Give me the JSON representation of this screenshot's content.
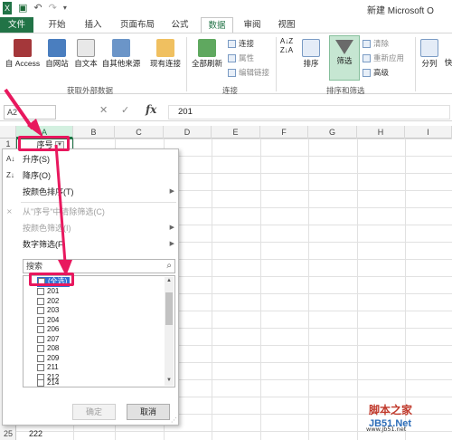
{
  "window": {
    "title": "新建 Microsoft O"
  },
  "tabs": [
    "文件",
    "开始",
    "插入",
    "页面布局",
    "公式",
    "数据",
    "审阅",
    "视图"
  ],
  "ribbon": {
    "from_access": "自 Access",
    "from_web": "自网站",
    "from_text": "自文本",
    "from_other": "自其他来源",
    "existing": "现有连接",
    "refresh_all": "全部刷新",
    "connections": "连接",
    "properties": "属性",
    "edit_links": "编辑链接",
    "sort": "排序",
    "filter": "筛选",
    "clear": "清除",
    "reapply": "重新应用",
    "advanced": "高级",
    "text_to_columns": "分列",
    "quick": "快",
    "group_external": "获取外部数据",
    "group_connections": "连接",
    "group_sort": "排序和筛选"
  },
  "formula_bar": {
    "name_box": "A2",
    "fx": "fx",
    "value": "201"
  },
  "columns": [
    "A",
    "B",
    "C",
    "D",
    "E",
    "F",
    "G",
    "H",
    "I"
  ],
  "sheet": {
    "a1": "序号",
    "row25_label": "25",
    "row25_value": "222",
    "row1_label": "1"
  },
  "filter_menu": {
    "sort_asc": "升序(S)",
    "sort_desc": "降序(O)",
    "sort_by_color": "按颜色排序(T)",
    "clear_filter": "从\"序号\"中清除筛选(C)",
    "filter_by_color": "按颜色筛选(I)",
    "number_filters": "数字筛选(F)",
    "search_placeholder": "搜索",
    "select_all": "(全选)",
    "items": [
      "201",
      "202",
      "203",
      "204",
      "206",
      "207",
      "208",
      "209",
      "211",
      "212",
      "214"
    ],
    "ok": "确定",
    "cancel": "取消"
  },
  "watermark": {
    "line1": "脚本之家",
    "line2": "JB51.Net",
    "line3": "www.jb51.net"
  }
}
